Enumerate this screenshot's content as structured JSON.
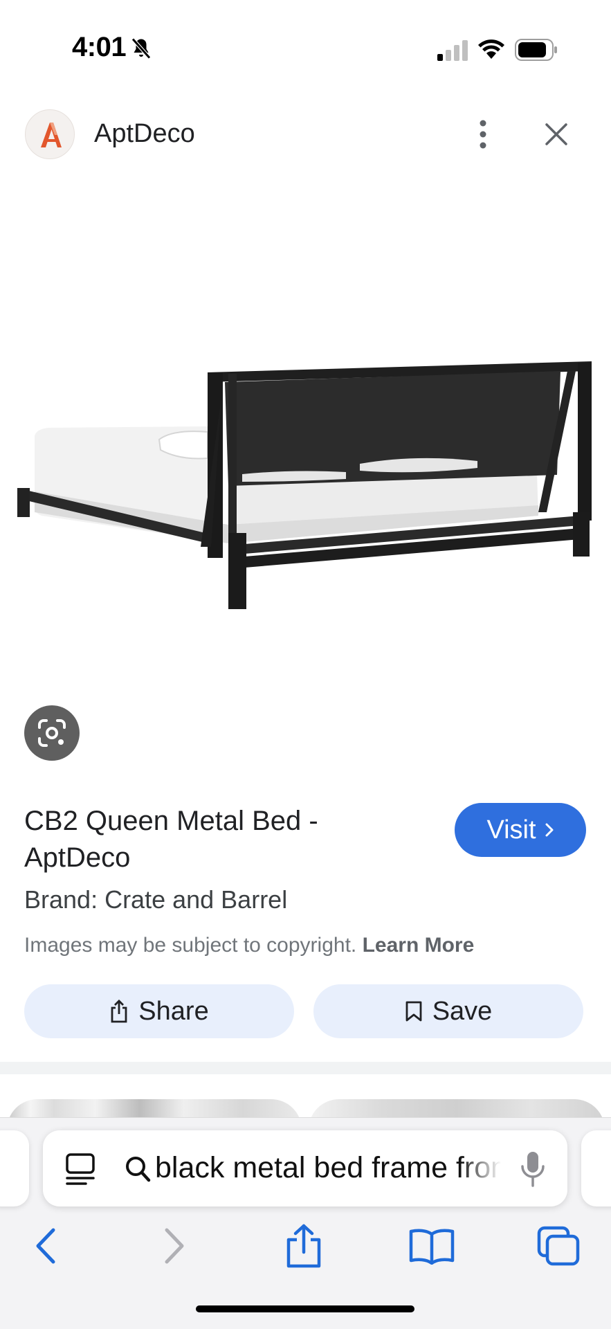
{
  "status_bar": {
    "time": "4:01",
    "icons": [
      "bell-slash-icon",
      "cellular-signal-icon",
      "wifi-icon",
      "battery-icon"
    ]
  },
  "header": {
    "site_name": "AptDeco",
    "logo_letter": "A",
    "logo_color": "#e2572d",
    "more_icon": "more-vertical-icon",
    "close_icon": "close-icon"
  },
  "lens": {
    "icon": "google-lens-icon"
  },
  "product": {
    "title": "CB2 Queen Metal Bed - AptDeco",
    "visit_label": "Visit",
    "brand_line": "Brand: Crate and Barrel",
    "copyright_text": "Images may be subject to copyright.",
    "learn_more_label": "Learn More",
    "share_label": "Share",
    "save_label": "Save"
  },
  "browser": {
    "address_text": "black metal bed frame from crate and barrel",
    "icons": [
      "reader-icon",
      "search-icon",
      "mic-icon",
      "back-icon",
      "forward-icon",
      "share-icon",
      "bookmarks-icon",
      "tabs-icon"
    ]
  },
  "colors": {
    "accent": "#2f6fde",
    "pill_bg": "#e8effc",
    "lens_bg": "#5f5f5f",
    "safari_blue": "#1f6bd9"
  }
}
